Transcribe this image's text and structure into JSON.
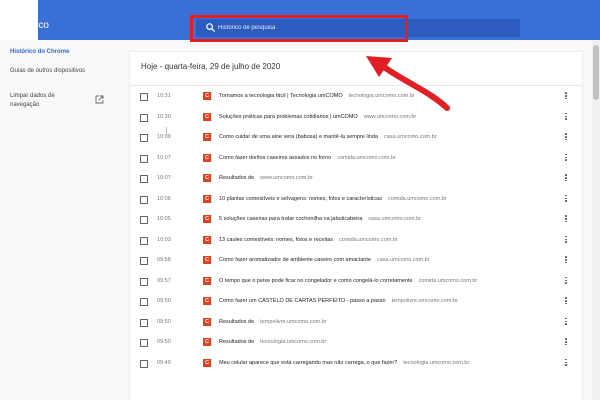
{
  "app": {
    "title": "Histórico"
  },
  "search": {
    "placeholder": "Histórico de pesquisa"
  },
  "sidebar": {
    "items": [
      {
        "label": "Histórico do Chrome"
      },
      {
        "label": "Guias de outros dispositivos"
      },
      {
        "label": "Limpar dados de navegação"
      }
    ]
  },
  "main": {
    "date_header": "Hoje - quarta-feira, 29 de julho de 2020",
    "entries": [
      {
        "time": "10:31",
        "title": "Tornamos a tecnologia fácil | Tecnologia umCOMO",
        "domain": "tecnologia.umcomo.com.br"
      },
      {
        "time": "10:30",
        "title": "Soluções práticas para problemas cotidianos | umCOMO",
        "domain": "www.umcomo.com.br"
      },
      {
        "time": "10:09",
        "title": "Como cuidar de uma aloe vera (babosa) e mantê-la sempre linda",
        "domain": "casa.umcomo.com.br"
      },
      {
        "time": "10:07",
        "title": "Como fazer doritos caseiros assados no forno",
        "domain": "comida.umcomo.com.br"
      },
      {
        "time": "10:07",
        "title": "Resultados de",
        "domain": "www.umcomo.com.br"
      },
      {
        "time": "10:06",
        "title": "10 plantas comestíveis e selvagens: nomes, fotos e características",
        "domain": "comida.umcomo.com.br"
      },
      {
        "time": "10:05",
        "title": "5 soluções caseiras para tratar cochonilha na jabuticabeira",
        "domain": "casa.umcomo.com.br"
      },
      {
        "time": "10:03",
        "title": "13 caules comestíveis: nomes, fotos e receitas",
        "domain": "comida.umcomo.com.br"
      },
      {
        "time": "09:58",
        "title": "Como fazer aromatizador de ambiente caseiro com amaciante",
        "domain": "casa.umcomo.com.br"
      },
      {
        "time": "09:57",
        "title": "O tempo que o peixe pode ficar no congelador e como congelá-lo corretamente",
        "domain": "comida.umcomo.com.br"
      },
      {
        "time": "09:50",
        "title": "Como fazer um CASTELO DE CARTAS PERFEITO - passo a passo",
        "domain": "tempolivre.umcomo.com.br"
      },
      {
        "time": "09:50",
        "title": "Resultados de",
        "domain": "tempolivre.umcomo.com.br"
      },
      {
        "time": "09:50",
        "title": "Resultados de",
        "domain": "tecnologia.umcomo.com.br"
      },
      {
        "time": "09:49",
        "title": "Meu celular aparece que está carregando mas não carrega, o que fazer?",
        "domain": "tecnologia.umcomo.com.br"
      }
    ]
  },
  "icons": {
    "favicon_letter": "C",
    "favicon_color": "#e2401f",
    "accent": "#3a6fd8",
    "annotation_color": "#e01e24"
  }
}
